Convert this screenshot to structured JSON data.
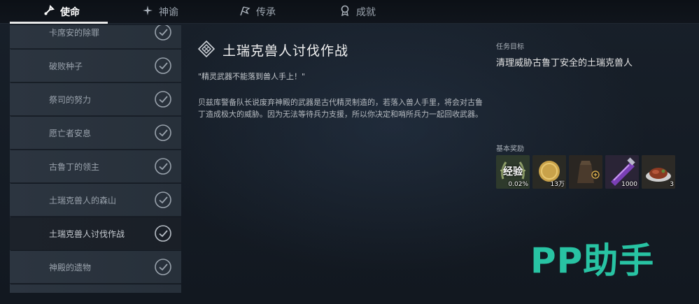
{
  "tabs": [
    {
      "label": "使命",
      "icon": "mission-icon",
      "active": true
    },
    {
      "label": "神谕",
      "icon": "star-icon",
      "active": false
    },
    {
      "label": "传承",
      "icon": "flag-icon",
      "active": false
    },
    {
      "label": "成就",
      "icon": "medal-icon",
      "active": false
    }
  ],
  "quest_list": [
    {
      "label": "卡席安的除罪",
      "completed": true,
      "selected": false
    },
    {
      "label": "破败种子",
      "completed": true,
      "selected": false
    },
    {
      "label": "祭司的努力",
      "completed": true,
      "selected": false
    },
    {
      "label": "愿亡者安息",
      "completed": true,
      "selected": false
    },
    {
      "label": "古鲁丁的领主",
      "completed": true,
      "selected": false
    },
    {
      "label": "土瑞克兽人的森山",
      "completed": true,
      "selected": false
    },
    {
      "label": "土瑞克兽人讨伐作战",
      "completed": true,
      "selected": true
    },
    {
      "label": "神殿的遗物",
      "completed": true,
      "selected": false
    }
  ],
  "quest": {
    "title": "土瑞克兽人讨伐作战",
    "quote": "\"精灵武器不能落到兽人手上！\"",
    "description": "贝兹库警备队长说废弃神殿的武器是古代精灵制造的，若落入兽人手里，将会对古鲁丁造成极大的威胁。因为无法等待兵力支援，所以你决定和哨所兵力一起回收武器。"
  },
  "objective": {
    "heading": "任务目标",
    "text": "清理威胁古鲁丁安全的土瑞克兽人"
  },
  "rewards": {
    "heading": "基本奖励",
    "items": [
      {
        "icon": "exp-laurel-icon",
        "label": "经验",
        "qty": "0.02%"
      },
      {
        "icon": "gold-coin-icon",
        "qty": "13万"
      },
      {
        "icon": "gear-bag-icon",
        "qty": ""
      },
      {
        "icon": "crystal-scroll-icon",
        "qty": "1000"
      },
      {
        "icon": "roast-meat-icon",
        "qty": "3"
      }
    ]
  },
  "watermark": "PP助手",
  "colors": {
    "background": "#141a22",
    "watermark": "#28c3a3",
    "list_item": "#2c3540",
    "list_selected": "#1c222a"
  }
}
